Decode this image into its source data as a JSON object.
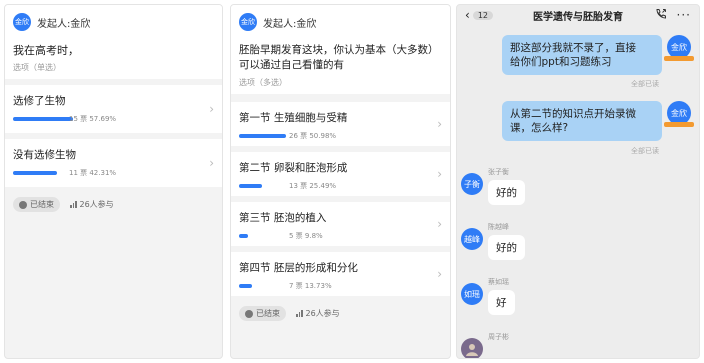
{
  "panel1": {
    "avatar": "金欣",
    "initiator": "发起人:金欣",
    "question": "我在高考时，",
    "type": "选项（单选）",
    "options": [
      {
        "label": "选修了生物",
        "stats": "15 票 57.69%",
        "percent": 57.69
      },
      {
        "label": "没有选修生物",
        "stats": "11 票 42.31%",
        "percent": 42.31
      }
    ],
    "status": "已结束",
    "participants": "26人参与"
  },
  "panel2": {
    "avatar": "金欣",
    "initiator": "发起人:金欣",
    "question_line1": "胚胎早期发育这块，你认为基本（大多数）",
    "question_line2": "可以通过自己看懂的有",
    "type": "选项（多选）",
    "options": [
      {
        "label": "第一节 生殖细胞与受精",
        "stats": "26 票 50.98%",
        "percent": 50.98
      },
      {
        "label": "第二节 卵裂和胚泡形成",
        "stats": "13 票 25.49%",
        "percent": 25.49
      },
      {
        "label": "第三节 胚泡的植入",
        "stats": "5 票 9.8%",
        "percent": 9.8
      },
      {
        "label": "第四节 胚层的形成和分化",
        "stats": "7 票 13.73%",
        "percent": 13.73
      }
    ],
    "status": "已结束",
    "participants": "26人参与"
  },
  "chat": {
    "back_count": "12",
    "title": "医学遗传与胚胎发育",
    "outgoing": [
      {
        "line1": "那这部分我就不录了，直接",
        "line2": "给你们ppt和习题练习",
        "read": "全部已读",
        "avatar": "金欣"
      },
      {
        "line1": "从第二节的知识点开始录微",
        "line2": "课，怎么样?",
        "read": "全部已读",
        "avatar": "金欣"
      }
    ],
    "incoming": [
      {
        "avatar": "子衡",
        "sender": "张子衡",
        "text": "好的"
      },
      {
        "avatar": "越峰",
        "sender": "陈越峰",
        "text": "好的"
      },
      {
        "avatar": "如瑶",
        "sender": "蔡如瑶",
        "text": "好"
      },
      {
        "avatar": "",
        "sender": "周子彬",
        "text": ""
      }
    ]
  }
}
